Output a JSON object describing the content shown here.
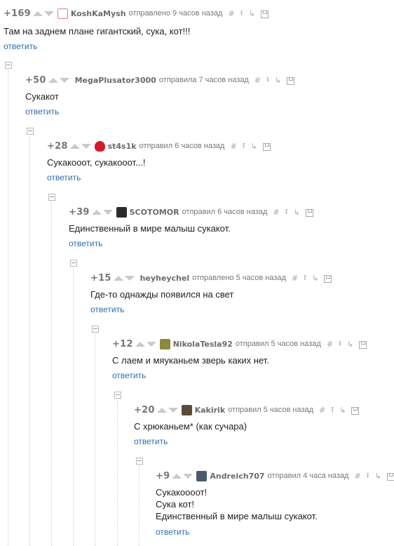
{
  "comments": [
    {
      "rating": "+169",
      "nick": "KoshKaMysh",
      "meta": "отправлено 9 часов назад",
      "text": [
        "Там на заднем плане гигантский, сука, кот!!!"
      ],
      "reply": "ответить",
      "avatar_color": "#d27db3"
    },
    {
      "rating": "+50",
      "nick": "MegaPlusator3000",
      "meta": "отправила 7 часов назад",
      "text": [
        "Сукакот"
      ],
      "reply": "ответить",
      "avatar_color": ""
    },
    {
      "rating": "+28",
      "nick": "st4s1k",
      "meta": "отправил 6 часов назад",
      "text": [
        "Сукакооот, сукакооот...!"
      ],
      "reply": "ответить",
      "avatar_color": "#d31a2c"
    },
    {
      "rating": "+39",
      "nick": "SCOTOMOR",
      "meta": "отправил 6 часов назад",
      "text": [
        "Единственный в мире малыш сукакот."
      ],
      "reply": "ответить",
      "avatar_color": "#2b2b2b"
    },
    {
      "rating": "+15",
      "nick": "heyheychel",
      "meta": "отправлено 5 часов назад",
      "text": [
        "Где-то однажды появился на свет"
      ],
      "reply": "ответить",
      "avatar_color": ""
    },
    {
      "rating": "+12",
      "nick": "NikolaTesla92",
      "meta": "отправил 5 часов назад",
      "text": [
        "С лаем и мяуканьем зверь каких нет."
      ],
      "reply": "ответить",
      "avatar_color": "#8a8a3a"
    },
    {
      "rating": "+20",
      "nick": "Kakirik",
      "meta": "отправил 5 часов назад",
      "text": [
        "С хрюканьем* (как сучара)"
      ],
      "reply": "ответить",
      "avatar_color": "#5a4a3a"
    },
    {
      "rating": "+9",
      "nick": "Andreich707",
      "meta": "отправил 4 часа назад",
      "text": [
        "Сукакоооот!",
        "Сука кот!",
        "Единственный в мире малыш сукакот."
      ],
      "reply": "ответить",
      "avatar_color": "#4a5a6a"
    }
  ],
  "tool_icons": [
    "hash-icon",
    "arrow-up-icon",
    "branch-icon",
    "save-icon"
  ],
  "tool_glyphs": {
    "hash": "#",
    "up": "⭱",
    "branch": "↳"
  },
  "link_color": "#2e6dad"
}
